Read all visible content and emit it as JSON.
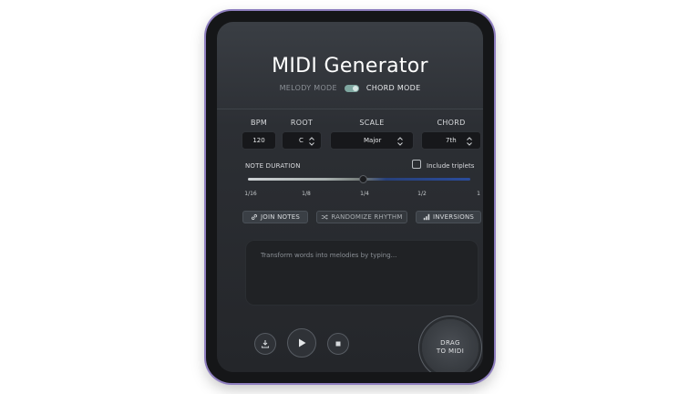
{
  "app": {
    "title": "MIDI Generator",
    "modes": {
      "melody_label": "MELODY MODE",
      "chord_label": "CHORD MODE",
      "active": "chord"
    }
  },
  "controls": {
    "bpm": {
      "label": "BPM",
      "value": "120"
    },
    "root": {
      "label": "ROOT",
      "value": "C"
    },
    "scale": {
      "label": "SCALE",
      "value": "Major"
    },
    "chord": {
      "label": "CHORD",
      "value": "7th"
    }
  },
  "note_duration": {
    "label": "NOTE DURATION",
    "ticks": [
      "1/16",
      "1/8",
      "1/4",
      "1/2",
      "1"
    ],
    "selected": "1/4",
    "triplets_label": "Include triplets",
    "triplets_checked": false
  },
  "actions": {
    "join_notes": "JOIN NOTES",
    "randomize_rhythm": "RANDOMIZE RHYTHM",
    "inversions": "INVERSIONS"
  },
  "input": {
    "placeholder": "Transform words into melodies by typing..."
  },
  "transport": {
    "download_icon": "download-icon",
    "play_icon": "play-icon",
    "stop_icon": "stop-icon",
    "drag_line1": "DRAG",
    "drag_line2": "TO MIDI"
  },
  "colors": {
    "accent_green": "#7fa7a0",
    "slider_blue": "#2a4c9c",
    "frame_purple": "#8f7fc0"
  }
}
